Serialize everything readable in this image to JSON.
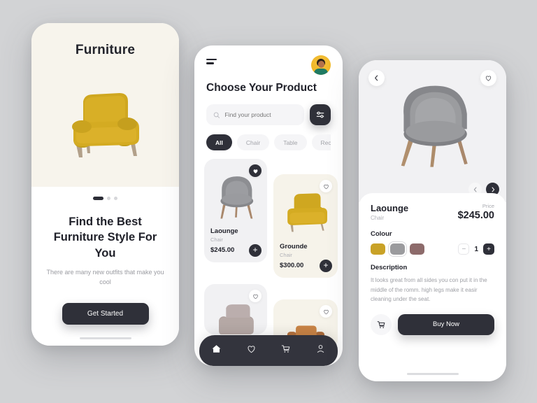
{
  "background_color": "#d2d3d5",
  "accent_dark": "#2f3039",
  "accent_yellow": "#c9a227",
  "screen1": {
    "brand_title": "Furniture",
    "hero_background": "#f7f4ec",
    "pagination": {
      "total": 3,
      "active_index": 0
    },
    "headline": "Find the Best Furniture Style For You",
    "subtext": "There are many new outfits that make you cool",
    "cta_label": "Get Started",
    "chair_color": "#c9a227"
  },
  "screen2": {
    "menu_icon": "hamburger-icon",
    "avatar_icon": "user-avatar",
    "title": "Choose Your Product",
    "search": {
      "placeholder": "Find your product",
      "value": "",
      "icon": "search-icon"
    },
    "filter_icon": "filter-sliders-icon",
    "categories": [
      {
        "label": "All",
        "active": true
      },
      {
        "label": "Chair",
        "active": false
      },
      {
        "label": "Table",
        "active": false
      },
      {
        "label": "Recomen",
        "active": false
      }
    ],
    "products": [
      {
        "name": "Laounge",
        "category": "Chair",
        "price": "$245.00",
        "favorite": true,
        "card_bg": "#f1f1f3",
        "chair_color": "#8d8e92",
        "add_label": "+"
      },
      {
        "name": "Grounde",
        "category": "Chair",
        "price": "$300.00",
        "favorite": false,
        "card_bg": "#f6f3ea",
        "chair_color": "#c9a227",
        "add_label": "+"
      }
    ],
    "partial_products": [
      {
        "card_bg": "#f1f1f3",
        "chair_color": "#b3a6a4",
        "favorite": false
      },
      {
        "card_bg": "#f6f1ea",
        "chair_color": "#c98446",
        "favorite": false
      }
    ],
    "bottom_nav": [
      {
        "icon": "home-icon",
        "active": true
      },
      {
        "icon": "heart-icon",
        "active": false
      },
      {
        "icon": "cart-icon",
        "active": false
      },
      {
        "icon": "profile-icon",
        "active": false
      }
    ]
  },
  "screen3": {
    "back_icon": "chevron-left-icon",
    "favorite_icon": "heart-icon",
    "hero_background": "#f1f1f3",
    "chair_color": "#8d8e92",
    "carousel": {
      "prev_icon": "chevron-left-icon",
      "next_icon": "chevron-right-icon",
      "next_active": true
    },
    "product_name": "Laounge",
    "product_category": "Chair",
    "price_label": "Price",
    "price_value": "$245.00",
    "colour_label": "Colour",
    "colours": [
      {
        "hex": "#c9a227",
        "selected": false
      },
      {
        "hex": "#9b9b9e",
        "selected": true
      },
      {
        "hex": "#8d6b6b",
        "selected": false
      }
    ],
    "quantity": {
      "minus_label": "−",
      "value": "1",
      "plus_label": "+"
    },
    "description_label": "Description",
    "description_text": "It looks great from all sides you con put it in the middle of the romm. high legs make it easir cleaning under the seat.",
    "cart_icon": "cart-icon",
    "buy_label": "Buy Now"
  }
}
